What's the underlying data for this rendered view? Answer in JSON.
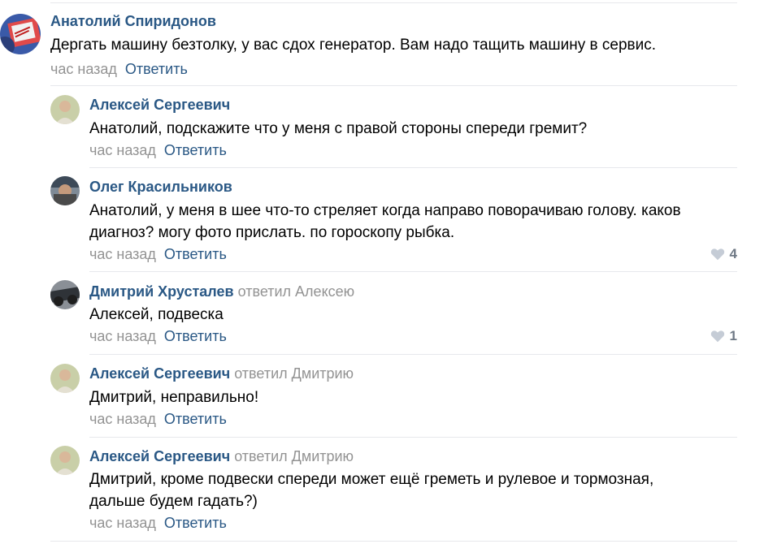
{
  "comments": [
    {
      "author": "Анатолий Спиридонов",
      "reply_to": "",
      "text": "Дергать машину безтолку, у вас сдох генератор. Вам надо тащить машину в сервис.",
      "time": "час назад",
      "reply_label": "Ответить",
      "likes": ""
    },
    {
      "author": "Алексей Сергеевич",
      "reply_to": "",
      "text": "Анатолий, подскажите что у меня с правой стороны спереди гремит?",
      "time": "час назад",
      "reply_label": "Ответить",
      "likes": ""
    },
    {
      "author": "Олег Красильников",
      "reply_to": "",
      "text_line1": "Анатолий, у меня в шее что-то стреляет когда направо поворачиваю голову. каков",
      "text_line2": "диагноз? могу фото прислать. по гороскопу рыбка.",
      "time": "час назад",
      "reply_label": "Ответить",
      "likes": "4"
    },
    {
      "author": "Дмитрий Хрусталев",
      "reply_to": "ответил Алексею",
      "text": "Алексей, подвеска",
      "time": "час назад",
      "reply_label": "Ответить",
      "likes": "1"
    },
    {
      "author": "Алексей Сергеевич",
      "reply_to": "ответил Дмитрию",
      "text": "Дмитрий, неправильно!",
      "time": "час назад",
      "reply_label": "Ответить",
      "likes": ""
    },
    {
      "author": "Алексей Сергеевич",
      "reply_to": "ответил Дмитрию",
      "text_line1": "Дмитрий, кроме подвески спереди может ещё греметь и рулевое и тормозная,",
      "text_line2": "дальше будем гадать?)",
      "time": "час назад",
      "reply_label": "Ответить",
      "likes": ""
    }
  ],
  "colors": {
    "author": "#2a5885",
    "muted": "#939393",
    "divider": "#e7e8ec",
    "like": "#6f7985"
  },
  "icons": {
    "like": "heart-icon"
  }
}
